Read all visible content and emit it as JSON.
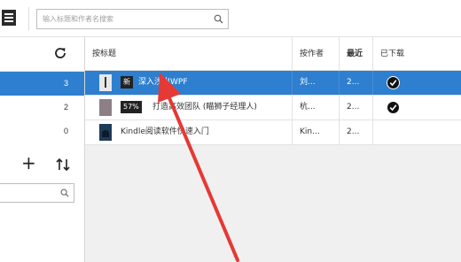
{
  "search": {
    "placeholder": "输入标题和作者名搜索"
  },
  "left_pane": {
    "counts": [
      "3",
      "2",
      "0"
    ],
    "selected_index": 0
  },
  "table": {
    "columns": [
      "按标题",
      "按作者",
      "最近",
      "已下载"
    ],
    "rows": [
      {
        "badge": "新",
        "title": "深入浅出WPF",
        "author": "刘...",
        "date": "2...",
        "downloaded": true,
        "selected": true
      },
      {
        "badge": "57%",
        "title": "打造高效团队 (瞄狮子经理人)",
        "author": "杭...",
        "date": "2...",
        "downloaded": true,
        "selected": false
      },
      {
        "badge": "",
        "title": "Kindle阅读软件快速入门",
        "author": "Kin...",
        "date": "2...",
        "downloaded": false,
        "selected": false
      }
    ]
  },
  "icons": {
    "menu": "hamburger-icon",
    "search": "search-icon",
    "refresh": "refresh-icon",
    "add": "plus-icon",
    "sort": "sort-icon",
    "downloaded": "check-circle-icon"
  },
  "colors": {
    "selection": "#2e7fcf",
    "annotation_arrow": "#e53935"
  }
}
